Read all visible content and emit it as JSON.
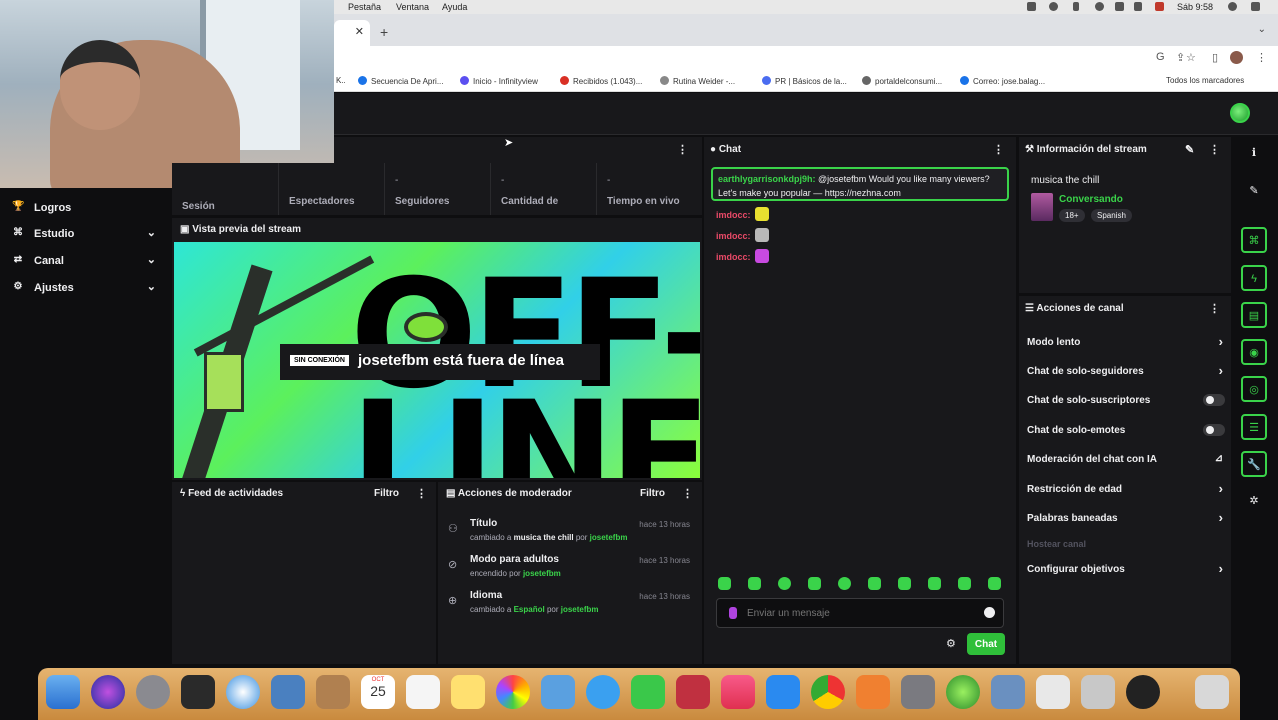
{
  "menubar": {
    "items": [
      "Pestaña",
      "Ventana",
      "Ayuda"
    ],
    "clock": "Sáb 9:58"
  },
  "browser": {
    "bookmarks": [
      {
        "label": "K..",
        "color": "#d33"
      },
      {
        "label": "Secuencia De Apri...",
        "color": "#1a73e8"
      },
      {
        "label": "Inicio - Infinityview",
        "color": "#5b4ff0"
      },
      {
        "label": "Recibidos (1.043)...",
        "color": "#d93025"
      },
      {
        "label": "Rutina Weider -...",
        "color": "#888"
      },
      {
        "label": "PR | Básicos de la...",
        "color": "#4a6cf0"
      },
      {
        "label": "portaldelconsumi...",
        "color": "#666"
      },
      {
        "label": "Correo: jose.balag...",
        "color": "#1a73e8"
      }
    ],
    "all_bookmarks": "Todos los marcadores"
  },
  "sidebar": {
    "items": [
      {
        "label": "Logros",
        "icon": "trophy-icon",
        "glyph": "🏆",
        "chevron": false
      },
      {
        "label": "Estudio",
        "icon": "studio-icon",
        "glyph": "⌘",
        "chevron": true
      },
      {
        "label": "Canal",
        "icon": "channel-icon",
        "glyph": "⇄",
        "chevron": true
      },
      {
        "label": "Ajustes",
        "icon": "gear-icon",
        "glyph": "⚙",
        "chevron": true
      }
    ]
  },
  "stats": [
    {
      "value": "",
      "label": "Sesión"
    },
    {
      "value": "",
      "label": "Espectadores"
    },
    {
      "value": "-",
      "label": "Seguidores"
    },
    {
      "value": "-",
      "label": "Cantidad de"
    },
    {
      "value": "-",
      "label": "Tiempo en vivo"
    }
  ],
  "preview": {
    "title": "Vista previa del stream",
    "offline_tag": "SIN CONEXIÓN",
    "offline_message": "josetefbm está fuera de línea",
    "art_line1": "OFF-",
    "art_line2": "LINE"
  },
  "feed": {
    "title": "Feed de actividades",
    "filter": "Filtro"
  },
  "mod_actions": {
    "title": "Acciones de moderador",
    "filter": "Filtro",
    "rows": [
      {
        "title": "Título",
        "prefix": "cambiado a",
        "value": "musica the chill",
        "by": "por",
        "user": "josetefbm",
        "time": "hace 13 horas",
        "icon": "title-icon",
        "glyph": "⚇"
      },
      {
        "title": "Modo para adultos",
        "prefix": "encendido por",
        "value": "",
        "by": "",
        "user": "josetefbm",
        "time": "hace 13 horas",
        "icon": "adult-mode-icon",
        "glyph": "⊘"
      },
      {
        "title": "Idioma",
        "prefix": "cambiado a",
        "value": "Español",
        "by": "por",
        "user": "josetefbm",
        "time": "hace 13 horas",
        "icon": "globe-icon",
        "glyph": "⊕"
      }
    ]
  },
  "chat": {
    "title": "Chat",
    "highlight": {
      "user": "earthlygarrisonkdpj9h:",
      "text": " @josetefbm Would you like many viewers? Let's make you popular — https://nezhna.com"
    },
    "lines": [
      {
        "user": "imdocc:",
        "emote_color": "#e8e030"
      },
      {
        "user": "imdocc:",
        "emote_color": "#b8b8b8"
      },
      {
        "user": "imdocc:",
        "emote_color": "#c84ae0"
      }
    ],
    "input_placeholder": "Enviar un mensaje",
    "send_label": "Chat"
  },
  "info": {
    "title": "Información del stream",
    "stream_title": "musica the chill",
    "category": "Conversando",
    "tags": [
      "18+",
      "Spanish"
    ]
  },
  "channel_actions": {
    "title": "Acciones de canal",
    "rows": [
      {
        "label": "Modo lento",
        "control": "chevron",
        "disabled": false
      },
      {
        "label": "Chat de solo-seguidores",
        "control": "chevron",
        "disabled": false
      },
      {
        "label": "Chat de solo-suscriptores",
        "control": "toggle",
        "disabled": false
      },
      {
        "label": "Chat de solo-emotes",
        "control": "toggle",
        "disabled": false
      },
      {
        "label": "Moderación del chat con IA",
        "control": "external",
        "disabled": false
      },
      {
        "label": "Restricción de edad",
        "control": "chevron",
        "disabled": false
      },
      {
        "label": "Palabras baneadas",
        "control": "chevron",
        "disabled": false
      },
      {
        "label": "Hostear canal",
        "control": "none",
        "disabled": true
      },
      {
        "label": "Configurar objetivos",
        "control": "chevron",
        "disabled": false
      }
    ]
  },
  "right_rail": [
    {
      "icon": "info-icon",
      "glyph": "ℹ",
      "green": false
    },
    {
      "icon": "pencil-icon",
      "glyph": "✎",
      "green": false
    },
    {
      "icon": "studio-icon",
      "glyph": "⌘",
      "green": true
    },
    {
      "icon": "lightning-icon",
      "glyph": "ϟ",
      "green": true
    },
    {
      "icon": "note-icon",
      "glyph": "▤",
      "green": true
    },
    {
      "icon": "chat-bubble-icon",
      "glyph": "◉",
      "green": true
    },
    {
      "icon": "broadcast-icon",
      "glyph": "◎",
      "green": true
    },
    {
      "icon": "server-icon",
      "glyph": "☰",
      "green": true
    },
    {
      "icon": "wrench-icon",
      "glyph": "🔧",
      "green": true
    },
    {
      "icon": "extensions-icon",
      "glyph": "✲",
      "green": false
    }
  ],
  "dock": {
    "calendar_month": "OCT",
    "calendar_day": "25"
  }
}
